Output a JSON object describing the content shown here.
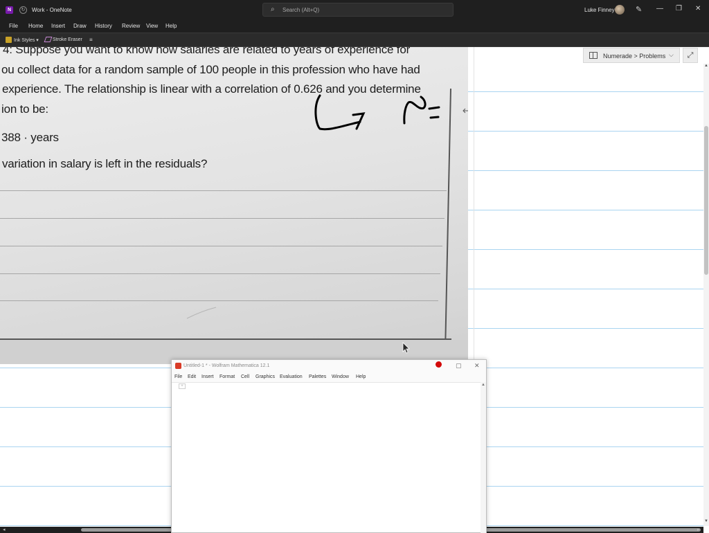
{
  "window": {
    "title": "Work - OneNote",
    "search_placeholder": "Search (Alt+Q)",
    "user_name": "Luke Finney"
  },
  "menu": {
    "items": [
      "File",
      "Home",
      "Insert",
      "Draw",
      "History",
      "Review",
      "View",
      "Help"
    ]
  },
  "toolbar": {
    "ink_styles": "Ink Styles",
    "stroke_eraser": "Stroke Eraser"
  },
  "photo": {
    "lines": [
      "4:  Suppose you want to know how salaries are related to years of experience for",
      "ou collect data for a random sample of 100 people in this profession who have had",
      "experience. The relationship is linear with a correlation of 0.626 and you determine",
      "ion to be:",
      "388 · years",
      "variation in salary is left in the residuals?"
    ]
  },
  "side_panel": {
    "breadcrumb": "Numerade > Problems"
  },
  "mathematica": {
    "title": "Untitled-1 * - Wolfram Mathematica 12.1",
    "menu": [
      "File",
      "Edit",
      "Insert",
      "Format",
      "Cell",
      "Graphics",
      "Evaluation",
      "Palettes",
      "Window",
      "Help"
    ]
  },
  "icons": {
    "search": "search-icon",
    "expand": "expand-icon",
    "chevron": "chevron-down-icon"
  },
  "colors": {
    "onenote_purple": "#7719aa",
    "titlebar": "#1f1f1f",
    "page_rule": "#a9d4f0",
    "mathematica_red": "#d83b27"
  }
}
